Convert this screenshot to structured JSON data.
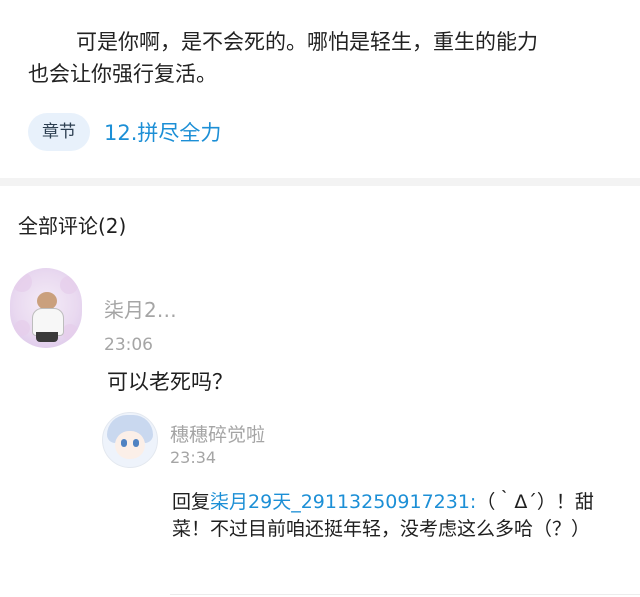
{
  "excerpt": {
    "line1": "可是你啊，是不会死的。哪怕是轻生，重生的能力",
    "line2": "也会让你强行复活。"
  },
  "chapter": {
    "tag": "章节",
    "title": "12.拼尽全力"
  },
  "comments": {
    "header": "全部评论(2)",
    "items": [
      {
        "username": "柒月2…",
        "time": "23:06",
        "content": "可以老死吗？",
        "replies": [
          {
            "username": "穗穗碎觉啦",
            "time": "23:34",
            "reply_prefix": "回复",
            "reply_to": "柒月29天_29113250917231:",
            "reply_text": "（｀Δ´）！甜菜！不过目前咱还挺年轻，没考虑这么多哈（？）"
          }
        ]
      }
    ]
  }
}
